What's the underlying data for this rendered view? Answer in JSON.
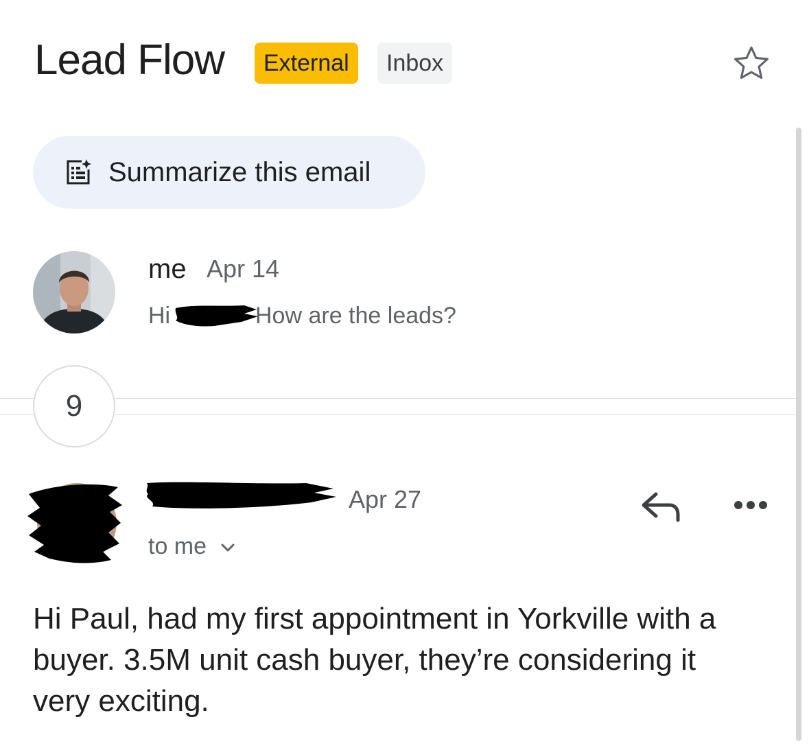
{
  "thread": {
    "subject": "Lead Flow",
    "labels": [
      "External",
      "Inbox"
    ],
    "colors": {
      "external_label": "#fbbc04",
      "inbox_label": "#f1f3f4",
      "summarize_bg": "#edf2fa"
    }
  },
  "actions": {
    "star_icon": "star-outline-icon",
    "summarize_icon": "summarize-spark-icon",
    "summarize_label": "Summarize this email"
  },
  "messages": [
    {
      "sender": "me",
      "date": "Apr 14",
      "snippet_greeting": "Hi",
      "snippet_body": "How are the leads?"
    },
    {
      "date": "Apr 27",
      "recipients": "to me",
      "reply_icon": "reply-icon",
      "more_icon": "more-horizontal-icon",
      "body": "Hi Paul, had my first appointment in Yorkville with a buyer. 3.5M unit cash buyer, they’re considering it very exciting."
    }
  ],
  "collapsed": {
    "count": "9"
  }
}
